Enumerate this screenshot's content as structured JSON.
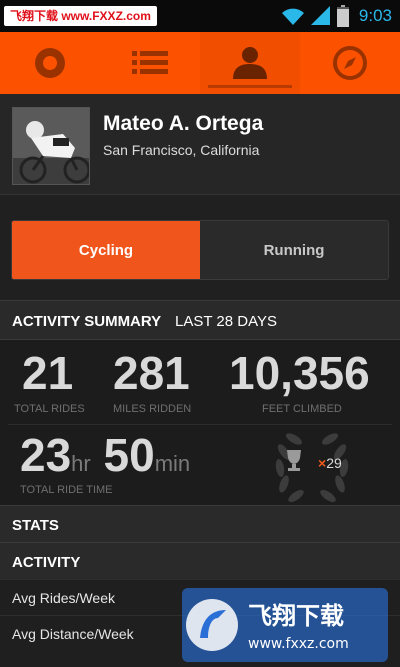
{
  "status_bar": {
    "watermark": "飞翔下载 www.FXXZ.com",
    "time": "9:03",
    "icons": [
      "wifi-icon",
      "signal-icon",
      "battery-icon"
    ]
  },
  "nav": {
    "tabs": [
      {
        "icon": "record-icon",
        "active": false
      },
      {
        "icon": "list-icon",
        "active": false
      },
      {
        "icon": "profile-icon",
        "active": true
      },
      {
        "icon": "compass-icon",
        "active": false
      }
    ],
    "accent": "#fc5200"
  },
  "profile": {
    "name": "Mateo A. Ortega",
    "location": "San Francisco, California"
  },
  "toggle": {
    "cycling": "Cycling",
    "running": "Running",
    "selected": "Cycling"
  },
  "summary": {
    "title": "ACTIVITY SUMMARY",
    "period": "LAST 28 DAYS",
    "total_rides": "21",
    "total_rides_label": "TOTAL RIDES",
    "miles": "281",
    "miles_label": "MILES RIDDEN",
    "feet": "10,356",
    "feet_label": "FEET CLIMBED",
    "hours": "23",
    "hours_unit": "hr",
    "minutes": "50",
    "minutes_unit": "min",
    "ride_time_label": "TOTAL RIDE TIME",
    "trophy_count": "29"
  },
  "stats": {
    "header": "STATS",
    "activity_header": "ACTIVITY",
    "rows": [
      "Avg Rides/Week",
      "Avg Distance/Week"
    ]
  },
  "watermark_bottom": {
    "title": "飞翔下载",
    "url": "www.fxxz.com"
  }
}
